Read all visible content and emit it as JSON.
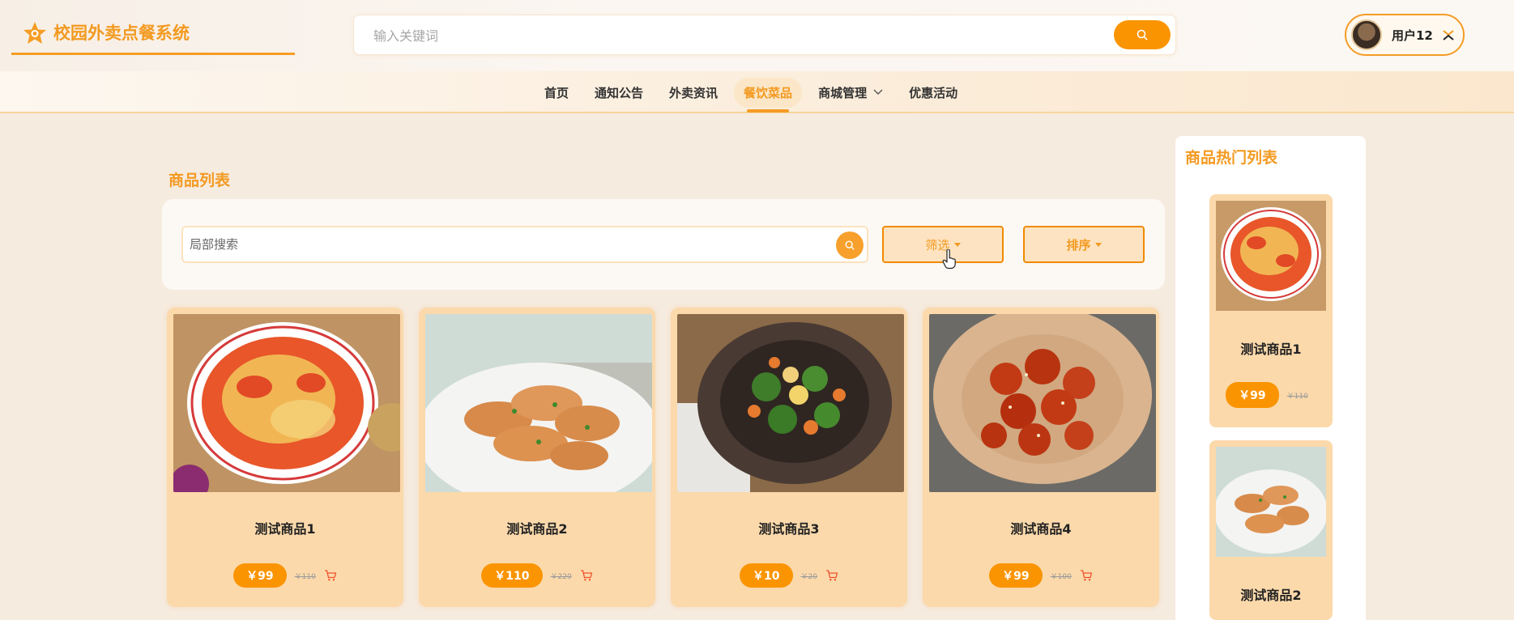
{
  "app": {
    "title": "校园外卖点餐系统",
    "accent_color": "#f39a21",
    "button_color": "#fa9400"
  },
  "header": {
    "search_placeholder": "输入关键词",
    "search_icon": "search-icon",
    "user_name": "用户12",
    "user_menu_icon": "swap-icon"
  },
  "nav": {
    "items": [
      {
        "label": "首页",
        "active": false
      },
      {
        "label": "通知公告",
        "active": false
      },
      {
        "label": "外卖资讯",
        "active": false
      },
      {
        "label": "餐饮菜品",
        "active": true
      },
      {
        "label": "商城管理",
        "active": false,
        "has_dropdown": true
      },
      {
        "label": "优惠活动",
        "active": false
      }
    ]
  },
  "main": {
    "section_title": "商品列表",
    "local_search_placeholder": "局部搜索",
    "filter_label": "筛选",
    "sort_label": "排序",
    "products": [
      {
        "name": "测试商品1",
        "price": "￥99",
        "old_price": "￥110"
      },
      {
        "name": "测试商品2",
        "price": "￥110",
        "old_price": "￥220"
      },
      {
        "name": "测试商品3",
        "price": "￥10",
        "old_price": "￥20"
      },
      {
        "name": "测试商品4",
        "price": "￥99",
        "old_price": "￥100"
      }
    ]
  },
  "sidebar": {
    "title": "商品热门列表",
    "items": [
      {
        "name": "测试商品1",
        "price": "￥99",
        "old_price": "￥110"
      },
      {
        "name": "测试商品2",
        "price": "",
        "old_price": ""
      }
    ]
  }
}
